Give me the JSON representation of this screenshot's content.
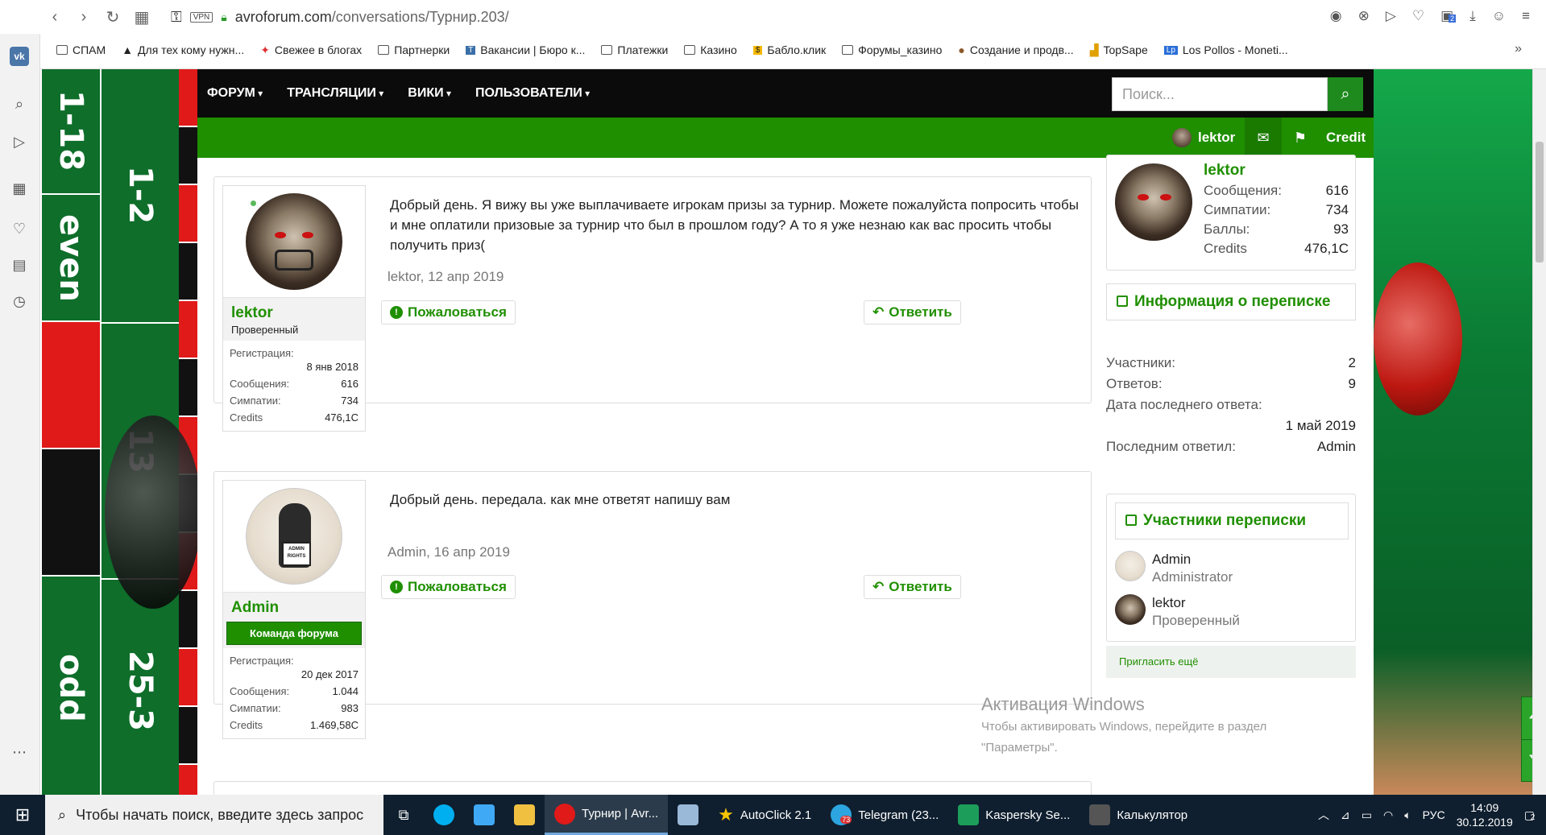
{
  "browser": {
    "url_host": "avroforum.com",
    "url_path": "/conversations/Турнир.203/",
    "vpn": "VPN",
    "bookmarks": [
      "СПАМ",
      "Для тех кому нужн...",
      "Свежее в блогах",
      "Партнерки",
      "Вакансии | Бюро к...",
      "Платежки",
      "Казино",
      "Бабло.клик",
      "Форумы_казино",
      "Создание и продв...",
      "TopSape",
      "Los Pollos - Moneti..."
    ],
    "more": "»",
    "ext_badge": "2"
  },
  "roulette": {
    "labels": [
      "1-18",
      "even",
      "odd",
      "1-2",
      "13",
      "25-3"
    ]
  },
  "nav": {
    "items": [
      "ФОРУМ",
      "ТРАНСЛЯЦИИ",
      "ВИКИ",
      "ПОЛЬЗОВАТЕЛИ"
    ],
    "search_placeholder": "Поиск..."
  },
  "userbar": {
    "username": "lektor",
    "credit": "Credit"
  },
  "messages": [
    {
      "author": "lektor",
      "title": "Проверенный",
      "info": {
        "reg_label": "Регистрация:",
        "reg_value": "8 янв 2018",
        "posts_label": "Сообщения:",
        "posts": "616",
        "likes_label": "Симпатии:",
        "likes": "734",
        "credits_label": "Credits",
        "credits": "476,1C"
      },
      "text": "Добрый день. Я вижу вы уже выплачиваете игрокам призы за турнир. Можете пожалуйста попросить чтобы и мне оплатили призовые за турнир что был в прошлом году? А то я уже незнаю как вас просить чтобы получить приз(",
      "meta": "lektor, 12 апр 2019",
      "report": "Пожаловаться",
      "reply": "Ответить"
    },
    {
      "author": "Admin",
      "banner": "Команда форума",
      "info": {
        "reg_label": "Регистрация:",
        "reg_value": "20 дек 2017",
        "posts_label": "Сообщения:",
        "posts": "1.044",
        "likes_label": "Симпатии:",
        "likes": "983",
        "credits_label": "Credits",
        "credits": "1.469,58C"
      },
      "sign_text": "ADMIN RIGHTS",
      "text": "Добрый день. передала. как мне ответят напишу вам",
      "meta": "Admin, 16 апр 2019",
      "report": "Пожаловаться",
      "reply": "Ответить"
    }
  ],
  "side_profile": {
    "name": "lektor",
    "posts_label": "Сообщения:",
    "posts": "616",
    "likes_label": "Симпатии:",
    "likes": "734",
    "points_label": "Баллы:",
    "points": "93",
    "credits_label": "Credits",
    "credits": "476,1C"
  },
  "conv_info": {
    "title": "Информация о переписке",
    "participants_label": "Участники:",
    "participants": "2",
    "replies_label": "Ответов:",
    "replies": "9",
    "last_date_label": "Дата последнего ответа:",
    "last_date": "1 май 2019",
    "last_by_label": "Последним ответил:",
    "last_by": "Admin"
  },
  "members": {
    "title": "Участники переписки",
    "list": [
      {
        "name": "Admin",
        "role": "Administrator"
      },
      {
        "name": "lektor",
        "role": "Проверенный"
      }
    ],
    "invite": "Пригласить ещё"
  },
  "activation": {
    "title": "Активация Windows",
    "line1": "Чтобы активировать Windows, перейдите в раздел",
    "line2": "\"Параметры\"."
  },
  "taskbar": {
    "search": "Чтобы начать поиск, введите здесь запрос",
    "apps": [
      "Турнир | Avr...",
      "AutoClick 2.1",
      "Telegram (23...",
      "Kaspersky Se...",
      "Калькулятор"
    ],
    "telegram_badge": "73",
    "lang": "РУС",
    "time": "14:09",
    "date": "30.12.2019",
    "notif": "2"
  }
}
